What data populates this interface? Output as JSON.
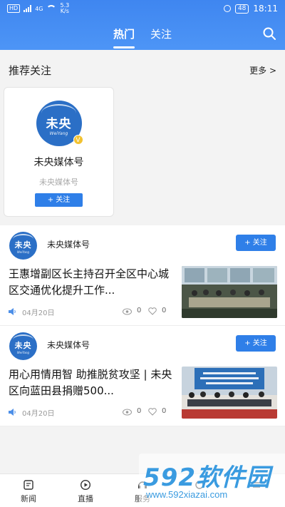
{
  "status_bar": {
    "network": "HD",
    "signal": "4G",
    "speed_value": "5.3",
    "speed_unit": "K/s",
    "battery": "48",
    "time": "18:11"
  },
  "header": {
    "tabs": [
      {
        "label": "热门",
        "active": true
      },
      {
        "label": "关注",
        "active": false
      }
    ]
  },
  "recommended": {
    "title": "推荐关注",
    "more": "更多 >",
    "card": {
      "logo_text": "未央",
      "logo_en": "WeiYang",
      "name": "未央媒体号",
      "subtitle": "未央媒体号",
      "follow_label": "+ 关注"
    }
  },
  "feed": [
    {
      "author": "未央媒体号",
      "logo_text": "未央",
      "logo_en": "WeiYang",
      "follow_label": "+ 关注",
      "title": "王惠增副区长主持召开全区中心城区交通优化提升工作...",
      "date": "04月20日",
      "views": "0",
      "likes": "0"
    },
    {
      "author": "未央媒体号",
      "logo_text": "未央",
      "logo_en": "WeiYang",
      "follow_label": "+ 关注",
      "title": "用心用情用智 助推脱贫攻坚 | 未央区向蓝田县捐赠500...",
      "date": "04月20日",
      "views": "0",
      "likes": "0"
    }
  ],
  "bottom_nav": [
    {
      "label": "新闻",
      "icon": "news-icon"
    },
    {
      "label": "直播",
      "icon": "live-icon"
    },
    {
      "label": "服务",
      "icon": "service-icon"
    },
    {
      "label": "",
      "icon": "hidden-icon"
    },
    {
      "label": "",
      "icon": "menu-icon"
    }
  ],
  "watermark": {
    "brand": "592软件园",
    "url": "www.592xiazai.com"
  },
  "colors": {
    "header": "#4d95f6",
    "accent": "#2f7fe8",
    "logo": "#2b6fc6",
    "watermark": "#3a9be0"
  }
}
